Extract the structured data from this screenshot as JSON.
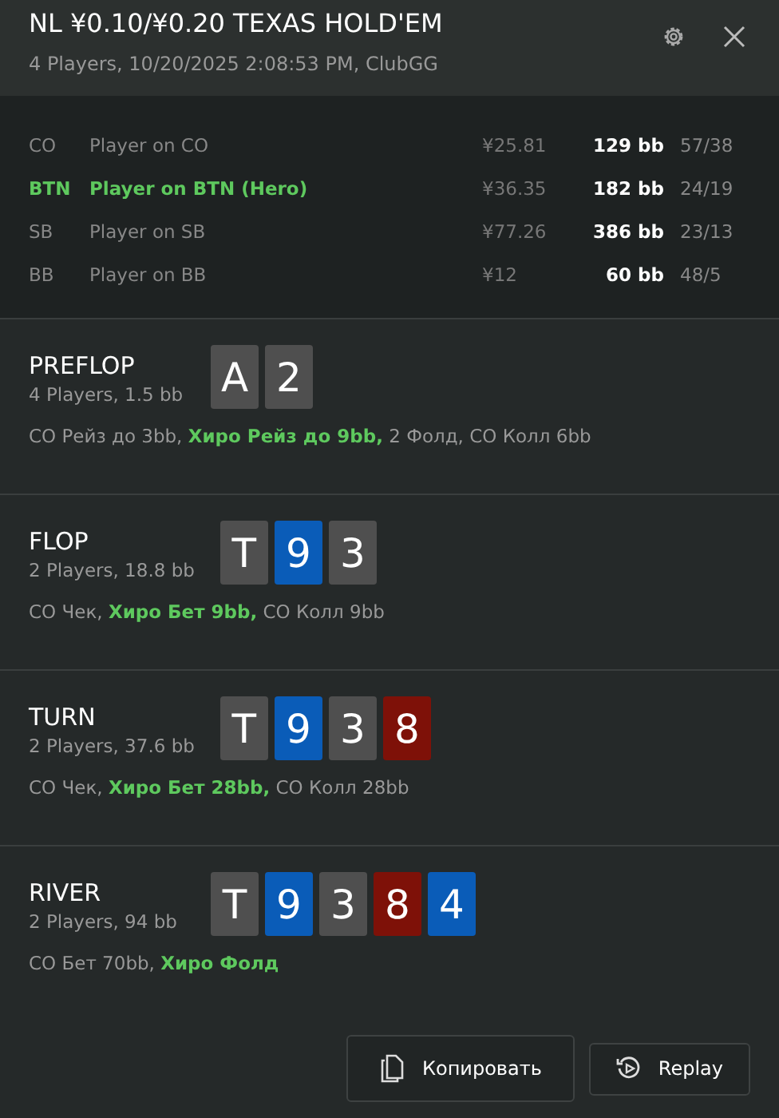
{
  "header": {
    "title": "NL ¥0.10/¥0.20 TEXAS HOLD'EM",
    "subtitle": "4 Players, 10/20/2025 2:08:53 PM, ClubGG"
  },
  "players": [
    {
      "position": "CO",
      "name": "Player on CO",
      "stack": "¥25.81",
      "bb": "129 bb",
      "stats": "57/38",
      "hero": false
    },
    {
      "position": "BTN",
      "name": "Player on BTN (Hero)",
      "stack": "¥36.35",
      "bb": "182 bb",
      "stats": "24/19",
      "hero": true
    },
    {
      "position": "SB",
      "name": "Player on SB",
      "stack": "¥77.26",
      "bb": "386 bb",
      "stats": "23/13",
      "hero": false
    },
    {
      "position": "BB",
      "name": "Player on BB",
      "stack": "¥12",
      "bb": "60 bb",
      "stats": "48/5",
      "hero": false
    }
  ],
  "streets": [
    {
      "name": "PREFLOP",
      "info": "4 Players, 1.5 bb",
      "cards": [
        {
          "rank": "A",
          "color": "#4f4f4f"
        },
        {
          "rank": "2",
          "color": "#4f4f4f"
        }
      ],
      "actions": [
        {
          "text": "CO Рейз до 3bb, ",
          "hero": false
        },
        {
          "text": "Хиро Рейз до 9bb,",
          "hero": true
        },
        {
          "text": " 2 Фолд, CO Колл 6bb",
          "hero": false
        }
      ]
    },
    {
      "name": "FLOP",
      "info": "2 Players, 18.8 bb",
      "cards": [
        {
          "rank": "T",
          "color": "#4f4f4f"
        },
        {
          "rank": "9",
          "color": "#0a5cb8"
        },
        {
          "rank": "3",
          "color": "#4f4f4f"
        }
      ],
      "actions": [
        {
          "text": "CO Чек, ",
          "hero": false
        },
        {
          "text": "Хиро Бет 9bb,",
          "hero": true
        },
        {
          "text": " CO Колл 9bb",
          "hero": false
        }
      ]
    },
    {
      "name": "TURN",
      "info": "2 Players, 37.6 bb",
      "cards": [
        {
          "rank": "T",
          "color": "#4f4f4f"
        },
        {
          "rank": "9",
          "color": "#0a5cb8"
        },
        {
          "rank": "3",
          "color": "#4f4f4f"
        },
        {
          "rank": "8",
          "color": "#7e1108"
        }
      ],
      "actions": [
        {
          "text": "CO Чек, ",
          "hero": false
        },
        {
          "text": "Хиро Бет 28bb,",
          "hero": true
        },
        {
          "text": " CO Колл 28bb",
          "hero": false
        }
      ]
    },
    {
      "name": "RIVER",
      "info": "2 Players, 94 bb",
      "cards": [
        {
          "rank": "T",
          "color": "#4f4f4f"
        },
        {
          "rank": "9",
          "color": "#0a5cb8"
        },
        {
          "rank": "3",
          "color": "#4f4f4f"
        },
        {
          "rank": "8",
          "color": "#7e1108"
        },
        {
          "rank": "4",
          "color": "#0a5cb8"
        }
      ],
      "actions": [
        {
          "text": "CO Бет 70bb, ",
          "hero": false
        },
        {
          "text": "Хиро Фолд",
          "hero": true
        }
      ]
    }
  ],
  "buttons": [
    {
      "label": "Копировать",
      "kind": "copy"
    },
    {
      "label": "Replay",
      "kind": "replay"
    }
  ]
}
